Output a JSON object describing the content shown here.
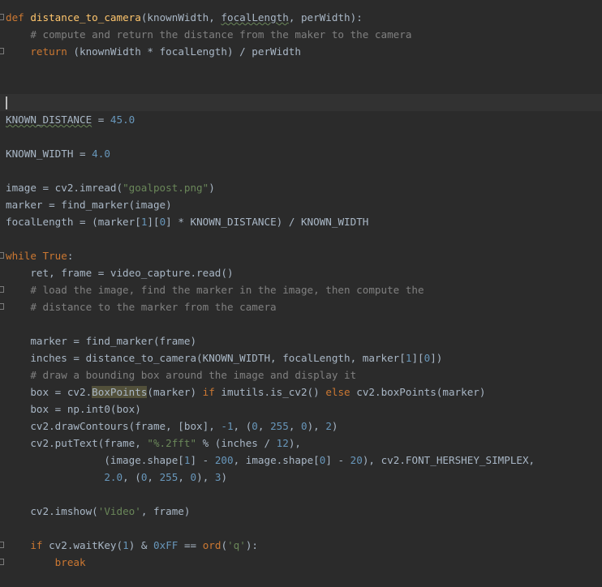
{
  "editor": {
    "language": "python",
    "theme": {
      "background": "#2b2b2b",
      "current_line": "#323232",
      "keyword": "#cc7832",
      "function": "#ffc66d",
      "comment": "#808080",
      "number": "#6897bb",
      "string": "#6a8759",
      "text": "#a9b7c6"
    },
    "lines": [
      {
        "tokens": [
          {
            "t": "def ",
            "c": "kw"
          },
          {
            "t": "distance_to_camera",
            "c": "fn"
          },
          {
            "t": "(knownWidth, ",
            "c": "tx"
          },
          {
            "t": "focalLength",
            "c": "tx",
            "u": true
          },
          {
            "t": ", perWidth):",
            "c": "tx"
          }
        ],
        "fold": true
      },
      {
        "tokens": [
          {
            "t": "    # compute and return the distance from the maker to the camera",
            "c": "cm"
          }
        ]
      },
      {
        "tokens": [
          {
            "t": "    ",
            "c": "tx"
          },
          {
            "t": "return ",
            "c": "kw"
          },
          {
            "t": "(knownWidth * focalLength) / perWidth",
            "c": "tx"
          }
        ],
        "fold": true
      },
      {
        "tokens": []
      },
      {
        "tokens": []
      },
      {
        "tokens": [],
        "current": true
      },
      {
        "tokens": [
          {
            "t": "KNOWN_DISTANCE",
            "c": "tx",
            "u": true
          },
          {
            "t": " = ",
            "c": "tx"
          },
          {
            "t": "45.0",
            "c": "num"
          }
        ]
      },
      {
        "tokens": []
      },
      {
        "tokens": [
          {
            "t": "KNOWN_WIDTH = ",
            "c": "tx"
          },
          {
            "t": "4.0",
            "c": "num"
          }
        ]
      },
      {
        "tokens": []
      },
      {
        "tokens": [
          {
            "t": "image = cv2.imread(",
            "c": "tx"
          },
          {
            "t": "\"goalpost.png\"",
            "c": "str"
          },
          {
            "t": ")",
            "c": "tx"
          }
        ]
      },
      {
        "tokens": [
          {
            "t": "marker = find_marker(image)",
            "c": "tx"
          }
        ]
      },
      {
        "tokens": [
          {
            "t": "focalLength = (marker[",
            "c": "tx"
          },
          {
            "t": "1",
            "c": "num"
          },
          {
            "t": "][",
            "c": "tx"
          },
          {
            "t": "0",
            "c": "num"
          },
          {
            "t": "] * KNOWN_DISTANCE) / KNOWN_WIDTH",
            "c": "tx"
          }
        ]
      },
      {
        "tokens": []
      },
      {
        "tokens": [
          {
            "t": "while ",
            "c": "kw"
          },
          {
            "t": "True",
            "c": "kw"
          },
          {
            "t": ":",
            "c": "tx"
          }
        ],
        "fold": true
      },
      {
        "tokens": [
          {
            "t": "    ret, frame = video_capture.read()",
            "c": "tx"
          }
        ]
      },
      {
        "tokens": [
          {
            "t": "    # load the image, find the marker in the image, then compute the",
            "c": "cm"
          }
        ],
        "fold": true
      },
      {
        "tokens": [
          {
            "t": "    # distance to the marker from the camera",
            "c": "cm"
          }
        ],
        "fold": true
      },
      {
        "tokens": []
      },
      {
        "tokens": [
          {
            "t": "    marker = find_marker(frame)",
            "c": "tx"
          }
        ]
      },
      {
        "tokens": [
          {
            "t": "    inches = distance_to_camera(KNOWN_WIDTH, focalLength, marker[",
            "c": "tx"
          },
          {
            "t": "1",
            "c": "num"
          },
          {
            "t": "][",
            "c": "tx"
          },
          {
            "t": "0",
            "c": "num"
          },
          {
            "t": "])",
            "c": "tx"
          }
        ]
      },
      {
        "tokens": [
          {
            "t": "    # draw a bounding box around the image and display it",
            "c": "cm"
          }
        ]
      },
      {
        "tokens": [
          {
            "t": "    box = cv2.",
            "c": "tx"
          },
          {
            "t": "BoxPoints",
            "c": "tx",
            "hl": true
          },
          {
            "t": "(marker) ",
            "c": "tx"
          },
          {
            "t": "if ",
            "c": "kw"
          },
          {
            "t": "imutils.is_cv2() ",
            "c": "tx"
          },
          {
            "t": "else ",
            "c": "kw"
          },
          {
            "t": "cv2.boxPoints(marker)",
            "c": "tx"
          }
        ]
      },
      {
        "tokens": [
          {
            "t": "    box = np.int0(box)",
            "c": "tx"
          }
        ]
      },
      {
        "tokens": [
          {
            "t": "    cv2.drawContours(frame, [box], ",
            "c": "tx"
          },
          {
            "t": "-1",
            "c": "num"
          },
          {
            "t": ", (",
            "c": "tx"
          },
          {
            "t": "0",
            "c": "num"
          },
          {
            "t": ", ",
            "c": "tx"
          },
          {
            "t": "255",
            "c": "num"
          },
          {
            "t": ", ",
            "c": "tx"
          },
          {
            "t": "0",
            "c": "num"
          },
          {
            "t": "), ",
            "c": "tx"
          },
          {
            "t": "2",
            "c": "num"
          },
          {
            "t": ")",
            "c": "tx"
          }
        ]
      },
      {
        "tokens": [
          {
            "t": "    cv2.putText(frame, ",
            "c": "tx"
          },
          {
            "t": "\"%.2fft\"",
            "c": "str"
          },
          {
            "t": " % (inches / ",
            "c": "tx"
          },
          {
            "t": "12",
            "c": "num"
          },
          {
            "t": "),",
            "c": "tx"
          }
        ]
      },
      {
        "tokens": [
          {
            "t": "                (image.shape[",
            "c": "tx"
          },
          {
            "t": "1",
            "c": "num"
          },
          {
            "t": "] - ",
            "c": "tx"
          },
          {
            "t": "200",
            "c": "num"
          },
          {
            "t": ", image.shape[",
            "c": "tx"
          },
          {
            "t": "0",
            "c": "num"
          },
          {
            "t": "] - ",
            "c": "tx"
          },
          {
            "t": "20",
            "c": "num"
          },
          {
            "t": "), cv2.FONT_HERSHEY_SIMPLEX,",
            "c": "tx"
          }
        ]
      },
      {
        "tokens": [
          {
            "t": "                ",
            "c": "tx"
          },
          {
            "t": "2.0",
            "c": "num"
          },
          {
            "t": ", (",
            "c": "tx"
          },
          {
            "t": "0",
            "c": "num"
          },
          {
            "t": ", ",
            "c": "tx"
          },
          {
            "t": "255",
            "c": "num"
          },
          {
            "t": ", ",
            "c": "tx"
          },
          {
            "t": "0",
            "c": "num"
          },
          {
            "t": "), ",
            "c": "tx"
          },
          {
            "t": "3",
            "c": "num"
          },
          {
            "t": ")",
            "c": "tx"
          }
        ]
      },
      {
        "tokens": []
      },
      {
        "tokens": [
          {
            "t": "    cv2.imshow(",
            "c": "tx"
          },
          {
            "t": "'Video'",
            "c": "str"
          },
          {
            "t": ", frame)",
            "c": "tx"
          }
        ]
      },
      {
        "tokens": []
      },
      {
        "tokens": [
          {
            "t": "    ",
            "c": "tx"
          },
          {
            "t": "if ",
            "c": "kw"
          },
          {
            "t": "cv2.waitKey(",
            "c": "tx"
          },
          {
            "t": "1",
            "c": "num"
          },
          {
            "t": ") & ",
            "c": "tx"
          },
          {
            "t": "0xFF",
            "c": "num"
          },
          {
            "t": " == ",
            "c": "tx"
          },
          {
            "t": "ord",
            "c": "kw"
          },
          {
            "t": "(",
            "c": "tx"
          },
          {
            "t": "'q'",
            "c": "str"
          },
          {
            "t": "):",
            "c": "tx"
          }
        ],
        "fold": true
      },
      {
        "tokens": [
          {
            "t": "        ",
            "c": "tx"
          },
          {
            "t": "break",
            "c": "kw"
          }
        ],
        "fold": true
      },
      {
        "tokens": []
      }
    ]
  }
}
